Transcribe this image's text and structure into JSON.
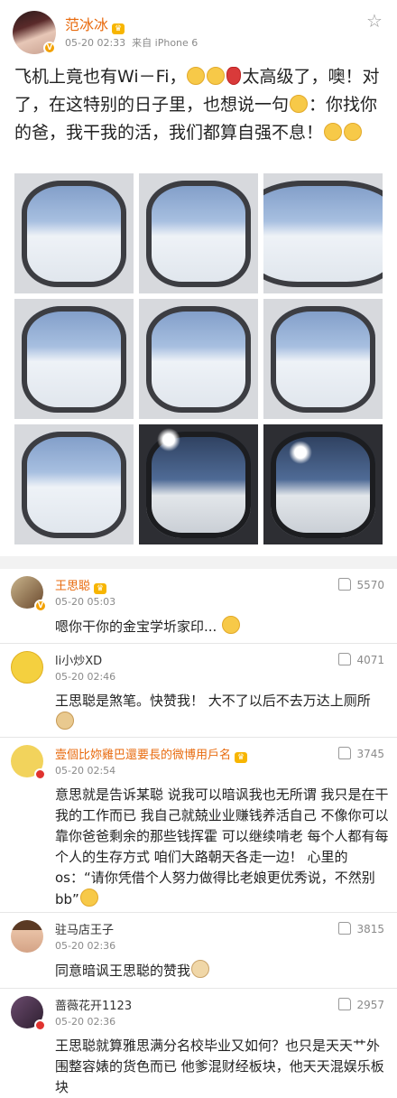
{
  "post": {
    "username": "范冰冰",
    "time": "05-20 02:33",
    "source": "来自 iPhone 6",
    "text_parts": [
      "飞机上竟也有Wi－Fi，",
      "太高级了，噢！对了，在这特别的日子里，也想说一句",
      "：你找你的爸，我干我的活，我们都算自强不息！"
    ],
    "icons": {
      "star": "star-icon",
      "verified": "verified-badge-icon",
      "vip": "crown-icon"
    }
  },
  "comments": [
    {
      "name": "王思聪",
      "time": "05-20 05:03",
      "likes": "5570",
      "text": "嗯你干你的金宝学圻家印..."
    },
    {
      "name": "li小炒XD",
      "time": "05-20 02:46",
      "likes": "4071",
      "text": "王思聪是煞笔。快赞我！ 大不了以后不去万达上厕所"
    },
    {
      "name": "壹個比妳雞巴還要長的微博用戶名",
      "time": "05-20 02:54",
      "likes": "3745",
      "text": "意思就是告诉某聪 说我可以暗讽我也无所谓 我只是在干我的工作而已 我自己就兢业业赚钱养活自己 不像你可以靠你爸爸剩余的那些钱挥霍 可以继续啃老 每个人都有每个人的生存方式 咱们大路朝天各走一边！ 心里的os：“请你凭借个人努力做得比老娘更优秀说，不然别bb”"
    },
    {
      "name": "驻马店王子",
      "time": "05-20 02:36",
      "likes": "3815",
      "text": "同意暗讽王思聪的赞我"
    },
    {
      "name": "蔷薇花开1123",
      "time": "05-20 02:36",
      "likes": "2957",
      "text": "王思聪就算雅思满分名校毕业又如何？也只是天天艹外围整容婊的货色而已 他爹混财经板块，他天天混娱乐板块"
    }
  ],
  "colors": {
    "accent": "#e86b0f",
    "meta": "#8a8a8a",
    "badge_gold": "#f2a100",
    "badge_red": "#e0332f"
  }
}
